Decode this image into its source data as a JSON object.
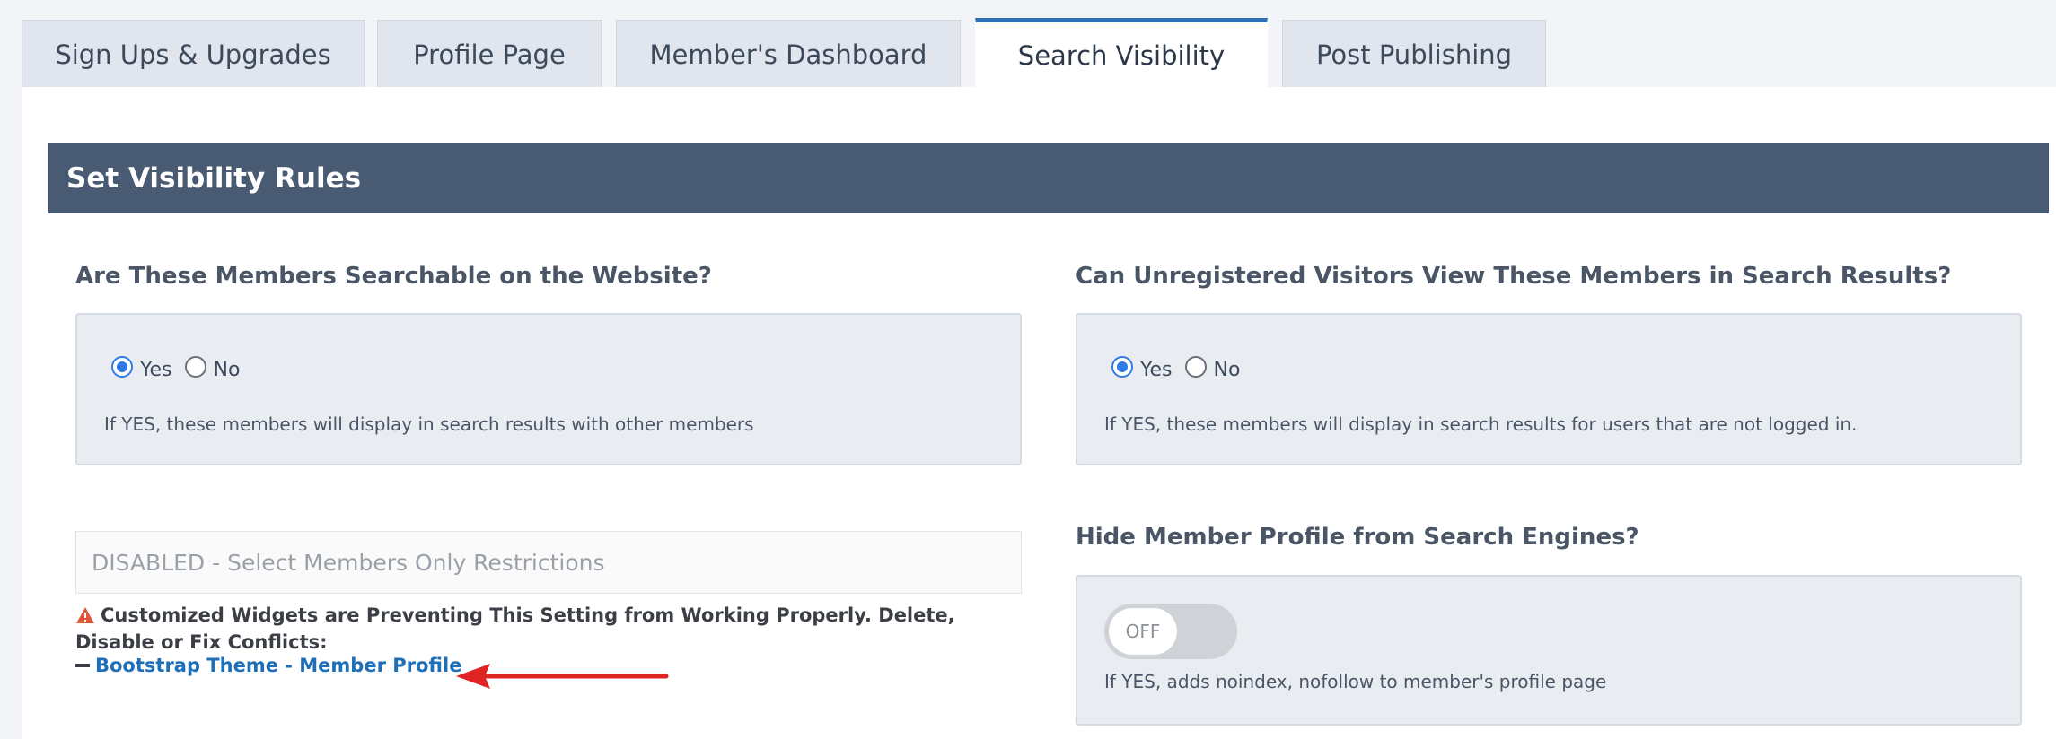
{
  "tabs": [
    {
      "label": "Sign Ups & Upgrades",
      "active": false
    },
    {
      "label": "Profile Page",
      "active": false
    },
    {
      "label": "Member's Dashboard",
      "active": false
    },
    {
      "label": "Search Visibility",
      "active": true
    },
    {
      "label": "Post Publishing",
      "active": false
    }
  ],
  "section": {
    "title": "Set Visibility Rules"
  },
  "searchable": {
    "question": "Are These Members Searchable on the Website?",
    "yes_label": "Yes",
    "no_label": "No",
    "selected": "Yes",
    "help": "If YES, these members will display in search results with other members"
  },
  "unregistered": {
    "question": "Can Unregistered Visitors View These Members in Search Results?",
    "yes_label": "Yes",
    "no_label": "No",
    "selected": "Yes",
    "help": "If YES, these members will display in search results for users that are not logged in."
  },
  "restrictions": {
    "disabled_text": "DISABLED - Select Members Only Restrictions",
    "warning": "Customized Widgets are Preventing This Setting from Working Properly. Delete, Disable or Fix Conflicts:",
    "conflict_link": "Bootstrap Theme - Member Profile"
  },
  "hide_profile": {
    "question": "Hide Member Profile from Search Engines?",
    "toggle_label": "OFF",
    "help": "If YES, adds noindex, nofollow to member's profile page"
  },
  "colors": {
    "header_bg": "#495b73",
    "accent": "#2f7ae5",
    "link": "#1f6fb8",
    "warning": "#e0573a",
    "arrow": "#e02424"
  }
}
